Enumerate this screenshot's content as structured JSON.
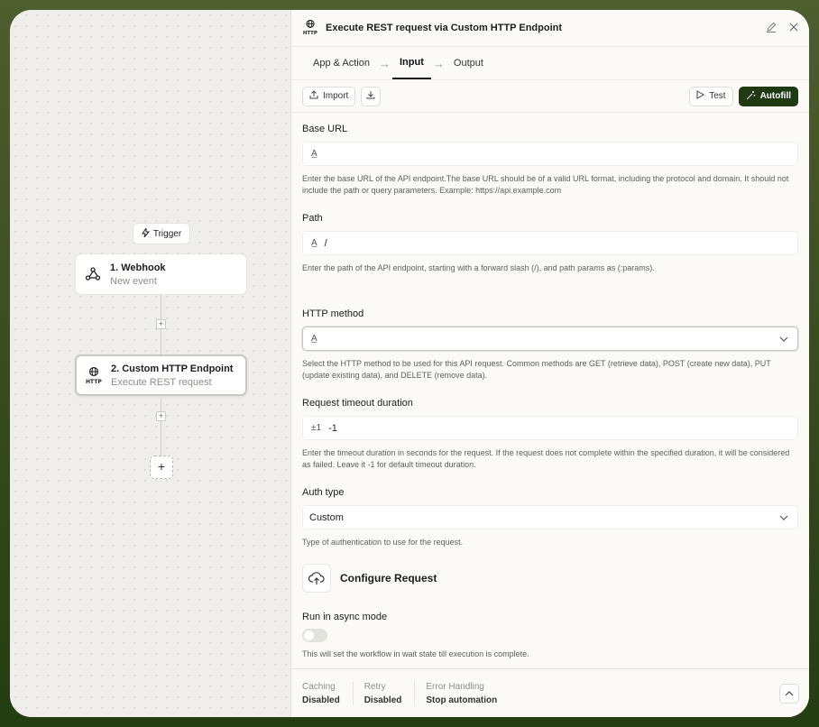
{
  "canvas": {
    "trigger_label": "Trigger",
    "nodes": [
      {
        "title": "1. Webhook",
        "subtitle": "New event"
      },
      {
        "title": "2. Custom HTTP Endpoint",
        "subtitle": "Execute REST request"
      }
    ],
    "add_symbol": "+"
  },
  "panel": {
    "title": "Execute REST request via Custom HTTP Endpoint",
    "tabs": [
      {
        "label": "App & Action"
      },
      {
        "label": "Input"
      },
      {
        "label": "Output"
      }
    ],
    "active_tab": "Input",
    "toolbar": {
      "import_label": "Import",
      "test_label": "Test",
      "autofill_label": "Autofill"
    },
    "fields": {
      "base_url": {
        "label": "Base URL",
        "value": "",
        "help": "Enter the base URL of the API endpoint.The base URL should be of a valid URL format, including the protocol and domain. It should not include the path or query parameters. Example: https://api.example.com"
      },
      "path": {
        "label": "Path",
        "value": "/",
        "help": "Enter the path of the API endpoint, starting with a forward slash (/), and path params as (:params)."
      },
      "http_method": {
        "label": "HTTP method",
        "value": "",
        "help": "Select the HTTP method to be used for this API request. Common methods are GET (retrieve data), POST (create new data), PUT (update existing data), and DELETE (remove data)."
      },
      "timeout": {
        "label": "Request timeout duration",
        "icon_text": "±1",
        "value": "-1",
        "help": "Enter the timeout duration in seconds for the request. If the request does not complete within the specified duration, it will be considered as failed. Leave it -1 for default timeout duration."
      },
      "auth_type": {
        "label": "Auth type",
        "value": "Custom",
        "help": "Type of authentication to use for the request."
      },
      "configure_label": "Configure Request",
      "async_mode": {
        "label": "Run in async mode",
        "enabled": false,
        "help": "This will set the workflow in wait state till execution is complete."
      }
    },
    "footer": {
      "caching": {
        "label": "Caching",
        "value": "Disabled"
      },
      "retry": {
        "label": "Retry",
        "value": "Disabled"
      },
      "error_handling": {
        "label": "Error Handling",
        "value": "Stop automation"
      }
    }
  },
  "colors": {
    "accent": "#1f3a13",
    "background": "#34491c"
  }
}
